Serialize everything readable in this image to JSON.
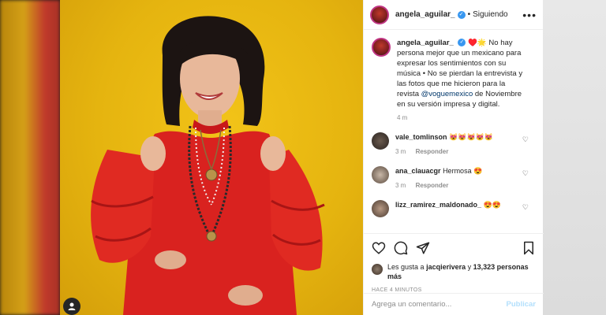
{
  "header": {
    "username": "angela_aguilar_",
    "separator": "•",
    "follow_state": "Siguiendo",
    "more": "•••"
  },
  "caption": {
    "username": "angela_aguilar_",
    "emojis": "♥️🌟",
    "text": "No hay persona mejor que un mexicano para expresar los sentimientos con su música • No se pierdan la entrevista y las fotos que me hicieron para la revista",
    "mention": "@voguemexico",
    "text_end": "de Noviembre en su versión impresa y digital.",
    "time": "4 m"
  },
  "comments": [
    {
      "username": "vale_tomlinson",
      "text": "😻😻😻😻😻",
      "time": "3 m",
      "reply": "Responder"
    },
    {
      "username": "ana_clauacgr",
      "text": "Hermosa 😍",
      "time": "3 m",
      "reply": "Responder"
    },
    {
      "username": "lizz_ramirez_maldonado_",
      "text": "😍😍",
      "time": "",
      "reply": ""
    }
  ],
  "likes": {
    "prefix": "Les gusta a",
    "user": "jacqierivera",
    "conj": "y",
    "count": "13,323 personas más"
  },
  "time_ago": "HACE 4 MINUTOS",
  "add_comment": {
    "placeholder": "Agrega un comentario...",
    "publish": "Publicar"
  },
  "colors": {
    "accent": "#3897f0",
    "publish_disabled": "#b2dffc",
    "background_photo": "#e5b40f",
    "dress": "#d9221f"
  },
  "icons": [
    "heart-icon",
    "comment-icon",
    "share-icon",
    "bookmark-icon",
    "user-tag-icon",
    "more-icon",
    "verified-icon"
  ]
}
